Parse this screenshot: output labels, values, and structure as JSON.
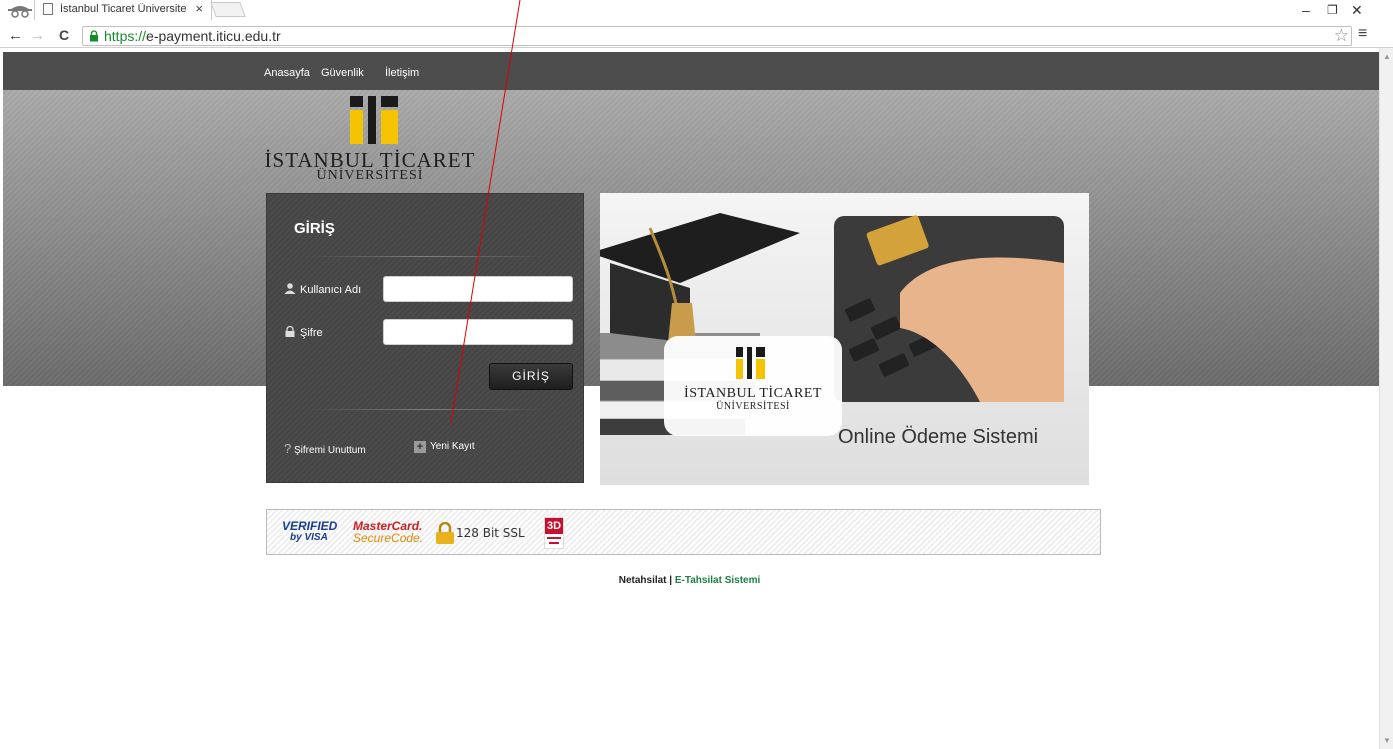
{
  "browser": {
    "tab_title": "İstanbul Ticaret Üniversite",
    "tab_close": "×",
    "url_scheme": "https://",
    "url_host": "e-payment.iticu.edu.tr",
    "back": "←",
    "forward": "→",
    "reload": "C",
    "minimize": "–",
    "restore": "❐",
    "close": "✕",
    "bookmark": "☆",
    "menu": "≡"
  },
  "nav": {
    "items": [
      "Anasayfa",
      "Güvenlik",
      "İletişim"
    ]
  },
  "logo": {
    "name": "İSTANBUL TİCARET",
    "sub": "ÜNİVERSİTESİ",
    "bar_color": "#f5c400"
  },
  "login": {
    "title": "GİRİŞ",
    "username_label": "Kullanıcı Adı",
    "password_label": "Şifre",
    "submit_label": "GİRİŞ",
    "forgot_label": "Şifremi Unuttum",
    "forgot_mark": "?",
    "register_label": "Yeni Kayıt",
    "register_mark": "+"
  },
  "banner": {
    "logo_name": "İSTANBUL TİCARET",
    "logo_sub": "ÜNİVERSİTESİ",
    "caption": "Online Ödeme Sistemi"
  },
  "security": {
    "visa_top": "VERIFIED",
    "visa_bottom": "by VISA",
    "mc_top": "MasterCard.",
    "mc_bottom": "SecureCode.",
    "ssl": "128 Bit SSL",
    "secure3d": "3D"
  },
  "footer": {
    "brand": "Netahsilat",
    "divider": " | ",
    "product": "E-Tahsilat Sistemi"
  },
  "colors": {
    "nav_bg": "#4d4d4d",
    "login_bg": "#4b4b4b",
    "accent_yellow": "#f5c400",
    "footer_green": "#1e8042",
    "annotation_red": "#e00000"
  }
}
